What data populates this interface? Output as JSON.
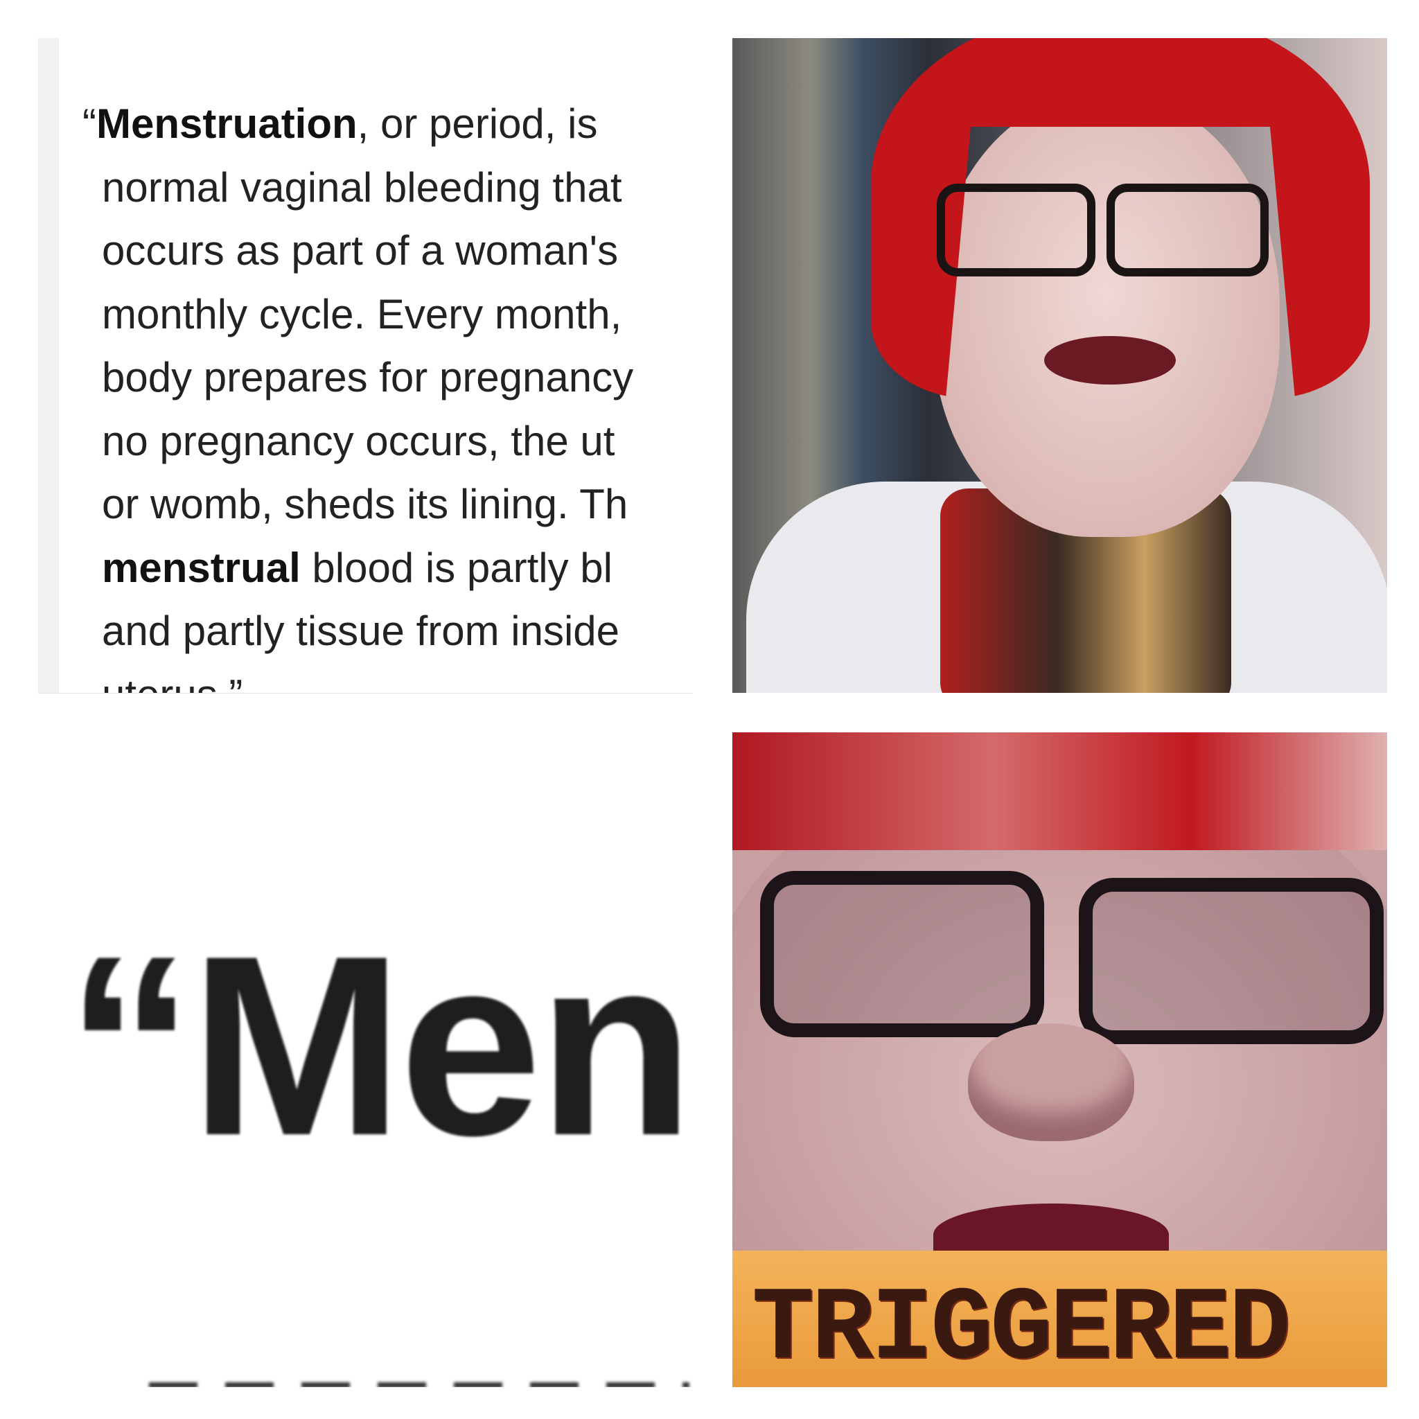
{
  "panels": {
    "top_left": {
      "lines": [
        {
          "open_quote": "“",
          "bold": "Menstruation",
          "rest": ", or period, is"
        },
        {
          "text": "normal vaginal bleeding that"
        },
        {
          "text": "occurs as part of a woman's"
        },
        {
          "text": "monthly cycle. Every month,"
        },
        {
          "text": "body prepares for pregnancy"
        },
        {
          "text": "no pregnancy occurs, the ut"
        },
        {
          "text": "or womb, sheds its lining. Th"
        },
        {
          "bold": "menstrual",
          "rest": " blood is partly bl"
        },
        {
          "text": "and partly tissue from inside"
        },
        {
          "text": "uterus.”"
        }
      ]
    },
    "top_right": {
      "image": "photo-woman-red-hair-glasses"
    },
    "bottom_left": {
      "zoomed_text": "“Mens"
    },
    "bottom_right": {
      "image": "photo-woman-closeup",
      "caption": "TRIGGERED",
      "caption_color": "#f0a848"
    }
  }
}
